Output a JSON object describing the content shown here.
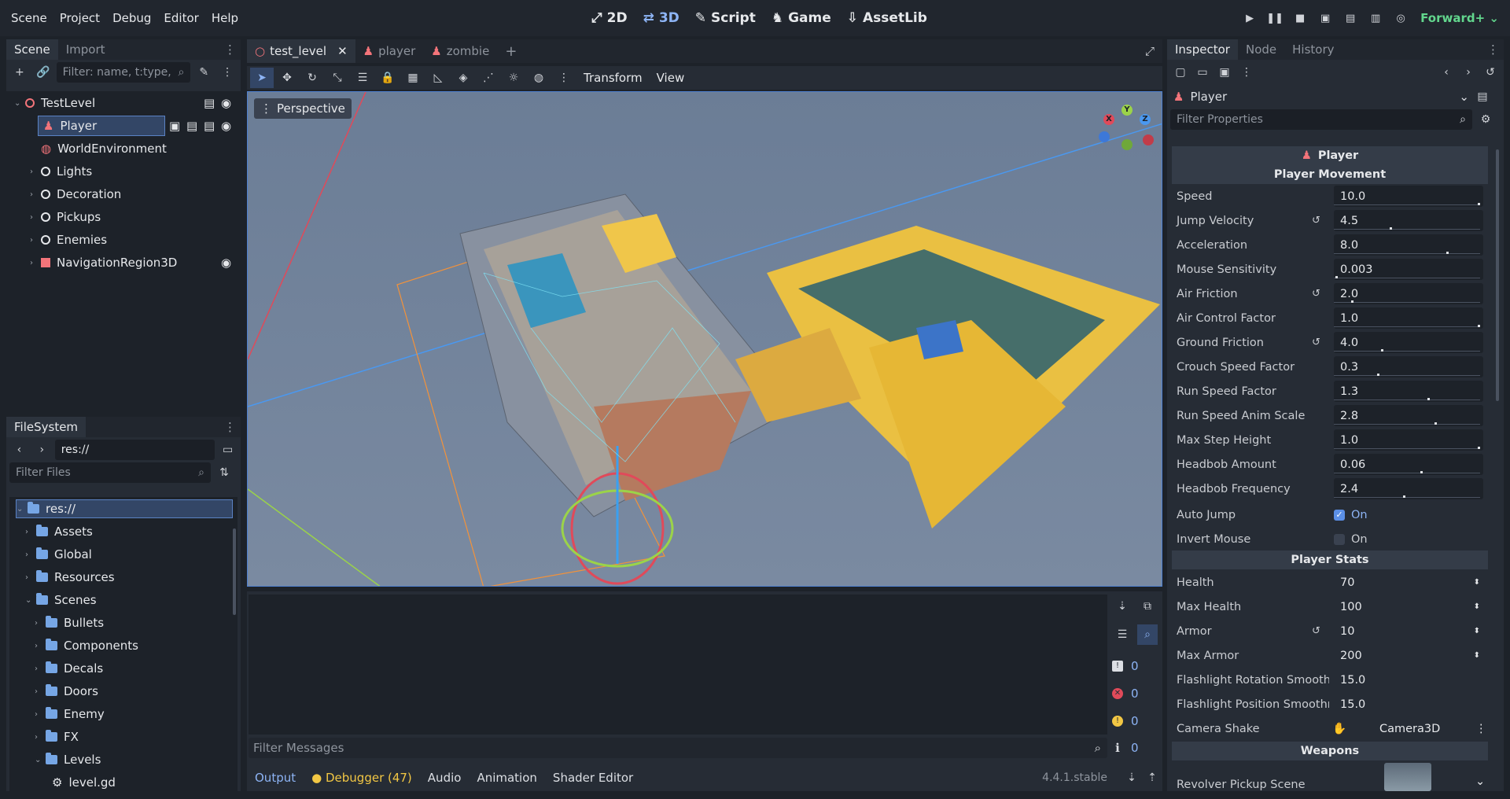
{
  "menu": [
    "Scene",
    "Project",
    "Debug",
    "Editor",
    "Help"
  ],
  "modes": [
    {
      "label": "2D",
      "icon": "2d-icon"
    },
    {
      "label": "3D",
      "icon": "3d-icon",
      "active": true
    },
    {
      "label": "Script",
      "icon": "script-icon"
    },
    {
      "label": "Game",
      "icon": "game-icon"
    },
    {
      "label": "AssetLib",
      "icon": "assetlib-icon"
    }
  ],
  "renderer": "Forward+",
  "scene_dock": {
    "tabs": [
      "Scene",
      "Import"
    ],
    "filter_placeholder": "Filter: name, t:type,",
    "nodes": [
      {
        "name": "TestLevel"
      },
      {
        "name": "Player"
      },
      {
        "name": "WorldEnvironment"
      },
      {
        "name": "Lights"
      },
      {
        "name": "Decoration"
      },
      {
        "name": "Pickups"
      },
      {
        "name": "Enemies"
      },
      {
        "name": "NavigationRegion3D"
      }
    ]
  },
  "filesystem": {
    "tab": "FileSystem",
    "path": "res://",
    "filter_placeholder": "Filter Files",
    "items": [
      "res://",
      "Assets",
      "Global",
      "Resources",
      "Scenes",
      "Bullets",
      "Components",
      "Decals",
      "Doors",
      "Enemy",
      "FX",
      "Levels",
      "level.gd"
    ]
  },
  "editor_tabs": [
    "test_level",
    "player",
    "zombie"
  ],
  "viewport": {
    "toolbar_transform": "Transform",
    "toolbar_view": "View",
    "perspective": "Perspective",
    "gizmo": {
      "x": "X",
      "y": "Y",
      "z": "Z"
    }
  },
  "output": {
    "filter_placeholder": "Filter Messages",
    "counts": [
      "0",
      "0",
      "0",
      "0"
    ]
  },
  "bottom_tabs": [
    "Output",
    "Debugger (47)",
    "Audio",
    "Animation",
    "Shader Editor"
  ],
  "version": "4.4.1.stable",
  "inspector": {
    "tabs": [
      "Inspector",
      "Node",
      "History"
    ],
    "node": "Player",
    "filter_placeholder": "Filter Properties",
    "title": "Player",
    "sections": [
      "Player Movement",
      "Player Stats",
      "Weapons"
    ],
    "movement": [
      {
        "label": "Speed",
        "value": "10.0",
        "ratio": 1.0
      },
      {
        "label": "Jump Velocity",
        "value": "4.5",
        "ratio": 0.39,
        "revert": true
      },
      {
        "label": "Acceleration",
        "value": "8.0",
        "ratio": 0.78
      },
      {
        "label": "Mouse Sensitivity",
        "value": "0.003",
        "ratio": 0.01
      },
      {
        "label": "Air Friction",
        "value": "2.0",
        "ratio": 0.12,
        "revert": true
      },
      {
        "label": "Air Control Factor",
        "value": "1.0",
        "ratio": 1.0
      },
      {
        "label": "Ground Friction",
        "value": "4.0",
        "ratio": 0.33,
        "revert": true
      },
      {
        "label": "Crouch Speed Factor",
        "value": "0.3",
        "ratio": 0.3
      },
      {
        "label": "Run Speed Factor",
        "value": "1.3",
        "ratio": 0.65
      },
      {
        "label": "Run Speed Anim Scale",
        "value": "2.8",
        "ratio": 0.7
      },
      {
        "label": "Max Step Height",
        "value": "1.0",
        "ratio": 1.0
      },
      {
        "label": "Headbob Amount",
        "value": "0.06",
        "ratio": 0.6
      },
      {
        "label": "Headbob Frequency",
        "value": "2.4",
        "ratio": 0.48
      }
    ],
    "auto_jump": {
      "label": "Auto Jump",
      "value": "On"
    },
    "invert_mouse": {
      "label": "Invert Mouse",
      "value": "On"
    },
    "stats": [
      {
        "label": "Health",
        "value": "70"
      },
      {
        "label": "Max Health",
        "value": "100"
      },
      {
        "label": "Armor",
        "value": "10",
        "revert": true
      },
      {
        "label": "Max Armor",
        "value": "200"
      }
    ],
    "flashlight": [
      {
        "label": "Flashlight Rotation Smoothn",
        "value": "15.0"
      },
      {
        "label": "Flashlight Position Smoothn",
        "value": "15.0"
      }
    ],
    "camera_shake": {
      "label": "Camera Shake",
      "value": "Camera3D"
    },
    "revolver": {
      "label": "Revolver Pickup Scene"
    }
  }
}
